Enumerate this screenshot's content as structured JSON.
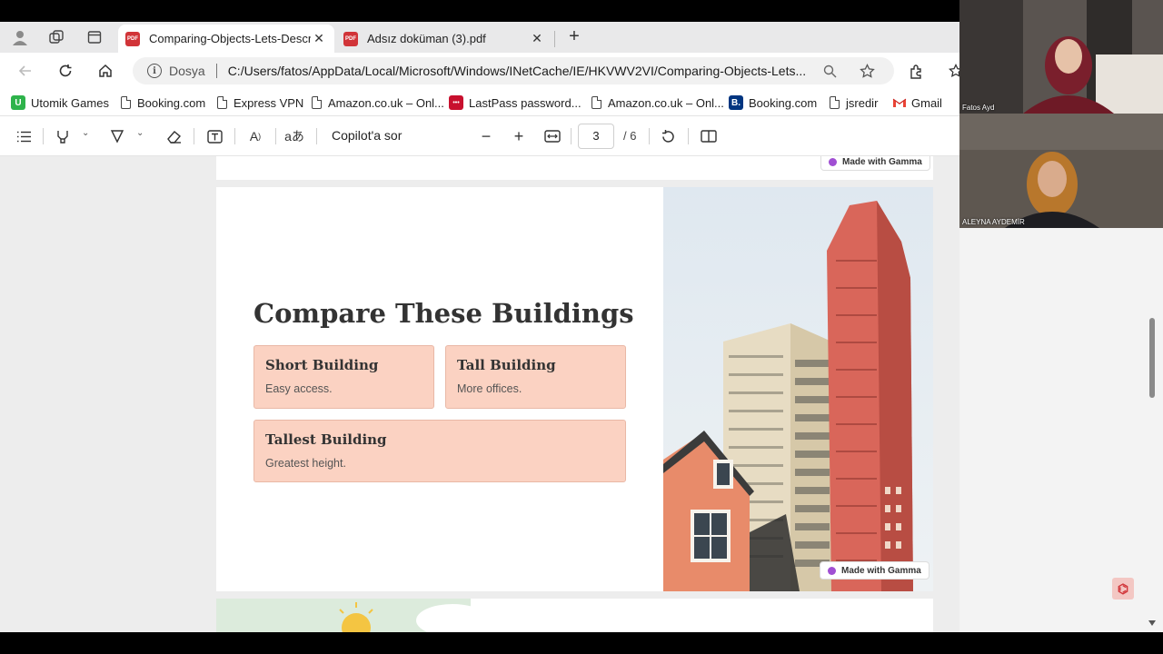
{
  "tabs": [
    {
      "title": "Comparing-Objects-Lets-Describe",
      "active": true,
      "icon": "pdf-icon",
      "close": "✕"
    },
    {
      "title": "Adsız doküman (3).pdf",
      "active": false,
      "icon": "pdf-icon",
      "close": "✕"
    }
  ],
  "new_tab": "+",
  "address": {
    "site_label": "Dosya",
    "url": "C:/Users/fatos/AppData/Local/Microsoft/Windows/INetCache/IE/HKVWV2VI/Comparing-Objects-Lets..."
  },
  "bookmarks": [
    {
      "label": "Utomik Games",
      "icon": "utomik-icon",
      "color": "#2eb34b"
    },
    {
      "label": "Booking.com",
      "icon": "page-icon"
    },
    {
      "label": "Express VPN",
      "icon": "page-icon"
    },
    {
      "label": "Amazon.co.uk – Onl...",
      "icon": "page-icon"
    },
    {
      "label": "LastPass password...",
      "icon": "lastpass-icon",
      "color": "#c8102e"
    },
    {
      "label": "Amazon.co.uk – Onl...",
      "icon": "page-icon"
    },
    {
      "label": "Booking.com",
      "icon": "booking-icon",
      "color": "#003580"
    },
    {
      "label": "jsredir",
      "icon": "page-icon"
    },
    {
      "label": "Gmail",
      "icon": "gmail-icon"
    }
  ],
  "pdf_toolbar": {
    "copilot": "Copilot'a sor",
    "current_page": "3",
    "total_pages": "/ 6"
  },
  "slide": {
    "title": "Compare These Buildings",
    "cards": [
      {
        "title": "Short Building",
        "desc": "Easy access."
      },
      {
        "title": "Tall Building",
        "desc": "More offices."
      },
      {
        "title": "Tallest Building",
        "desc": "Greatest height."
      }
    ],
    "badge": "Made with Gamma",
    "card_color": "#fbd2c2"
  },
  "prev_page_badge": "Made with Gamma",
  "participants": [
    {
      "name": "Fatos Ayd"
    },
    {
      "name": "ALEYNA AYDEMİR"
    }
  ]
}
